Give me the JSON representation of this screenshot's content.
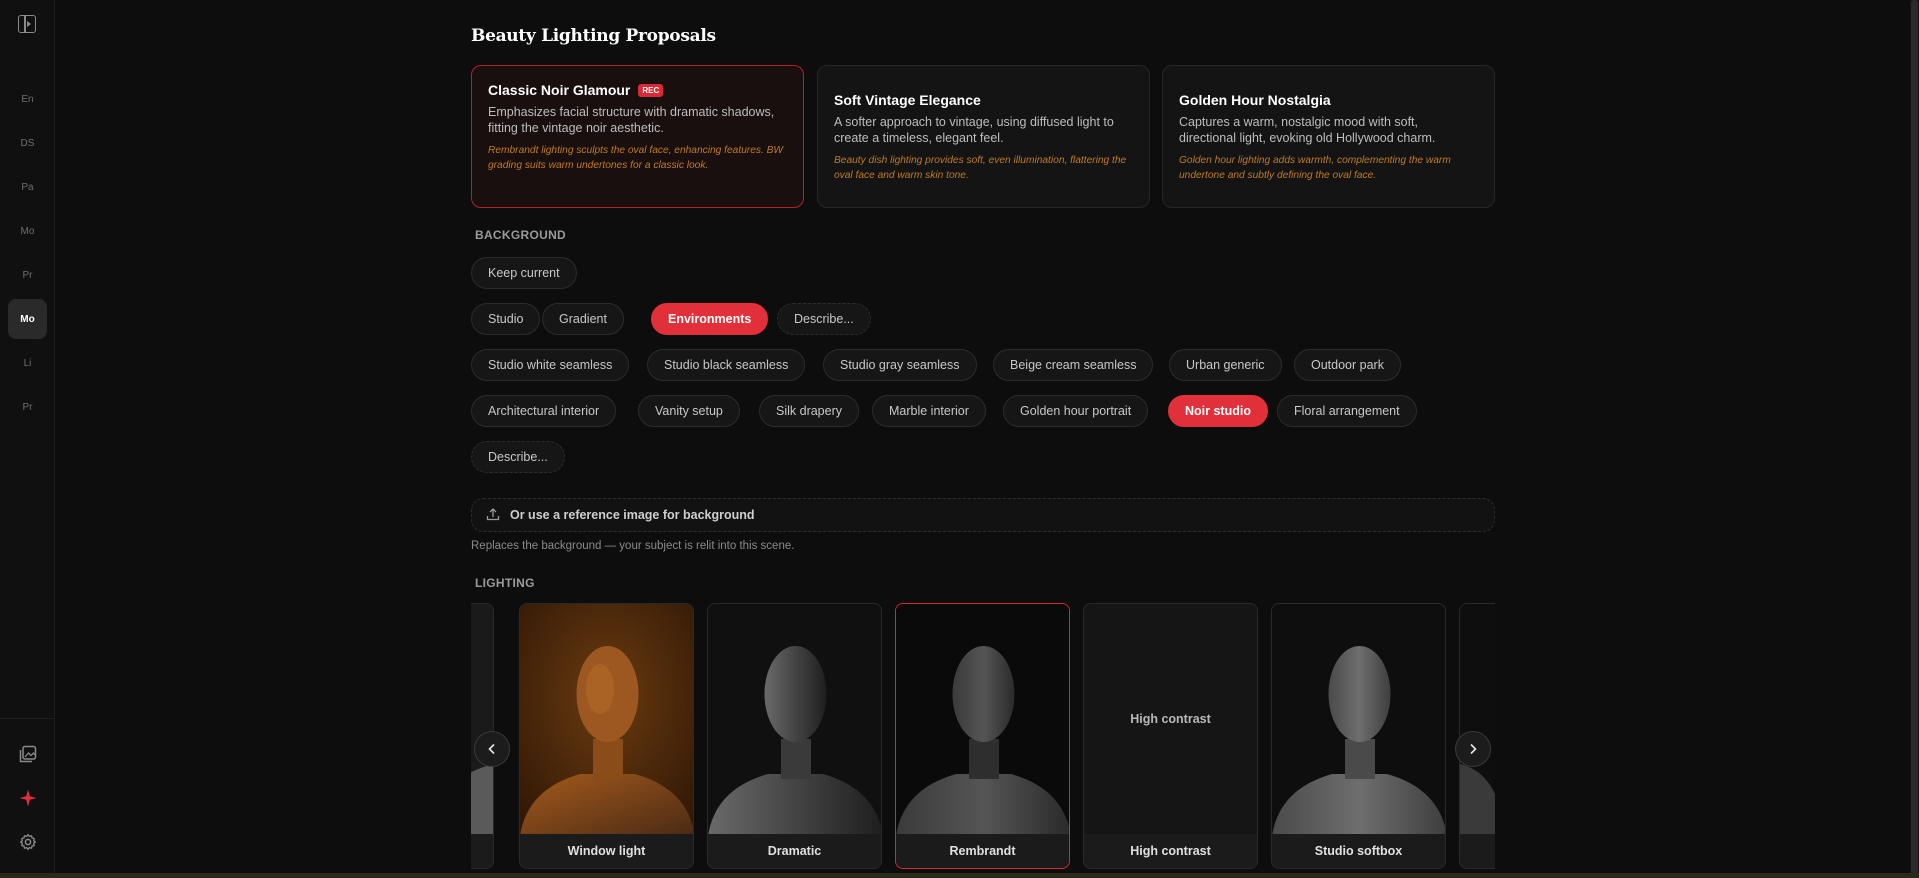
{
  "sidebar": {
    "items": [
      {
        "label": "En"
      },
      {
        "label": "DS"
      },
      {
        "label": "Pa"
      },
      {
        "label": "Mo"
      },
      {
        "label": "Pr"
      },
      {
        "label": "Mo",
        "active": true
      },
      {
        "label": "Li"
      },
      {
        "label": "Pr"
      }
    ],
    "bottom_icons": [
      "gallery-icon",
      "sparkle-icon",
      "gear-icon"
    ],
    "accent": "#e1303a"
  },
  "page": {
    "title": "Beauty Lighting Proposals"
  },
  "proposals": [
    {
      "title": "Classic Noir Glamour",
      "badge": "REC",
      "selected": true,
      "description": "Emphasizes facial structure with dramatic shadows, fitting the vintage noir aesthetic.",
      "note": "Rembrandt lighting sculpts the oval face, enhancing features. BW grading suits warm undertones for a classic look."
    },
    {
      "title": "Soft Vintage Elegance",
      "description": "A softer approach to vintage, using diffused light to create a timeless, elegant feel.",
      "note": "Beauty dish lighting provides soft, even illumination, flattering the oval face and warm skin tone."
    },
    {
      "title": "Golden Hour Nostalgia",
      "description": "Captures a warm, nostalgic mood with soft, directional light, evoking old Hollywood charm.",
      "note": "Golden hour lighting adds warmth, complementing the warm undertone and subtly defining the oval face."
    }
  ],
  "background": {
    "label": "BACKGROUND",
    "keep_current": "Keep current",
    "modes": [
      "Studio",
      "Gradient",
      "Environments",
      "Describe..."
    ],
    "active_mode": "Environments",
    "presets": [
      "Studio white seamless",
      "Studio black seamless",
      "Studio gray seamless",
      "Beige cream seamless",
      "Urban generic",
      "Outdoor park",
      "Architectural interior",
      "Vanity setup",
      "Silk drapery",
      "Marble interior",
      "Golden hour portrait",
      "Noir studio",
      "Floral arrangement",
      "Describe..."
    ],
    "active_preset": "Noir studio",
    "upload_label": "Or use a reference image for background",
    "hint": "Replaces the background — your subject is relit into this scene."
  },
  "lighting": {
    "label": "LIGHTING",
    "tiles": [
      {
        "label": "Window light",
        "tone": "warm"
      },
      {
        "label": "Dramatic",
        "tone": "dramatic"
      },
      {
        "label": "Rembrandt",
        "tone": "dark",
        "selected": true
      },
      {
        "label": "High contrast",
        "placeholder": "High contrast"
      },
      {
        "label": "Studio softbox",
        "tone": "soft"
      }
    ]
  }
}
